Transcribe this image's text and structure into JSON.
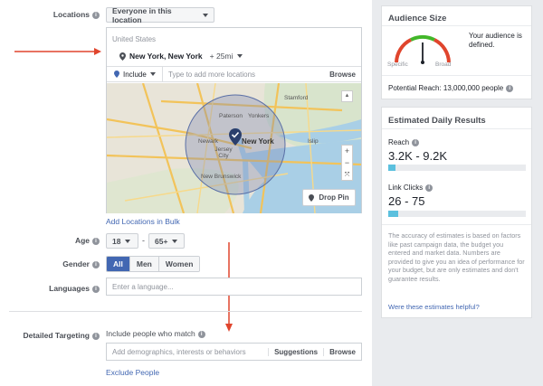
{
  "locations": {
    "label": "Locations",
    "dropdown": "Everyone in this location",
    "country": "United States",
    "city": "New York, New York",
    "radius": "+ 25mi",
    "include_label": "Include",
    "input_placeholder": "Type to add more locations",
    "browse": "Browse",
    "add_bulk": "Add Locations in Bulk",
    "drop_pin": "Drop Pin"
  },
  "map": {
    "places": [
      "Stamford",
      "Paterson",
      "Yonkers",
      "Newark",
      "Jersey City",
      "New York",
      "Islip",
      "New Brunswick"
    ]
  },
  "age": {
    "label": "Age",
    "min": "18",
    "max": "65+",
    "separator": "-"
  },
  "gender": {
    "label": "Gender",
    "options": [
      "All",
      "Men",
      "Women"
    ],
    "selected": "All"
  },
  "languages": {
    "label": "Languages",
    "placeholder": "Enter a language..."
  },
  "detailed": {
    "label": "Detailed Targeting",
    "include": "Include people who match",
    "placeholder": "Add demographics, interests or behaviors",
    "suggestions": "Suggestions",
    "browse": "Browse",
    "exclude": "Exclude People"
  },
  "audience": {
    "title": "Audience Size",
    "status": "Your audience is defined.",
    "specific": "Specific",
    "broad": "Broad",
    "potential": "Potential Reach: 13,000,000 people"
  },
  "results": {
    "title": "Estimated Daily Results",
    "reach_label": "Reach",
    "reach_value": "3.2K - 9.2K",
    "reach_fill": 0.05,
    "clicks_label": "Link Clicks",
    "clicks_value": "26 - 75",
    "clicks_fill": 0.07,
    "disclaimer": "The accuracy of estimates is based on factors like past campaign data, the budget you entered and market data. Numbers are provided to give you an idea of performance for your budget, but are only estimates and don't guarantee results.",
    "helpful": "Were these estimates helpful?"
  },
  "colors": {
    "accent": "#4267b2",
    "arrow": "#e0452d",
    "bar": "#5bc0de"
  }
}
